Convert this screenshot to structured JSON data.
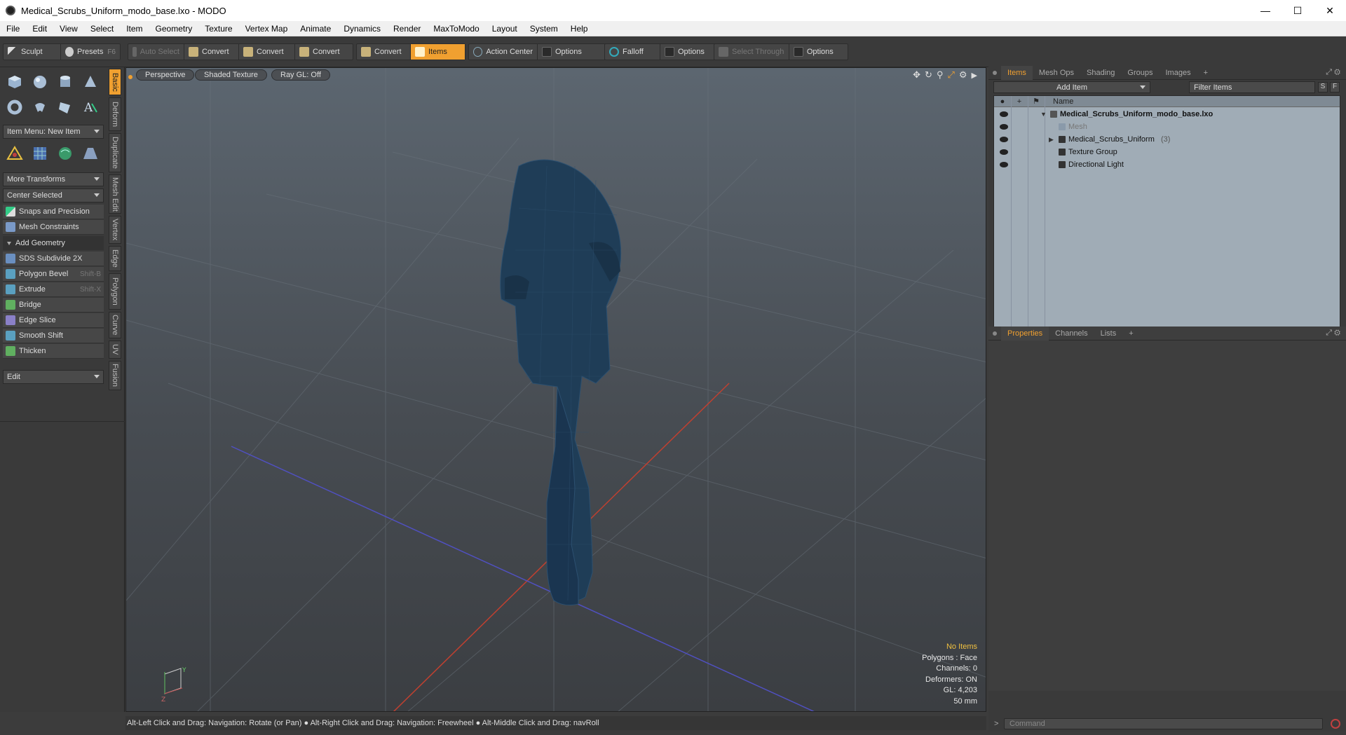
{
  "window": {
    "title": "Medical_Scrubs_Uniform_modo_base.lxo - MODO",
    "minimize": "—",
    "maximize": "☐",
    "close": "✕"
  },
  "menubar": [
    "File",
    "Edit",
    "View",
    "Select",
    "Item",
    "Geometry",
    "Texture",
    "Vertex Map",
    "Animate",
    "Dynamics",
    "Render",
    "MaxToModo",
    "Layout",
    "System",
    "Help"
  ],
  "toolbar": {
    "sculpt": "Sculpt",
    "presets": "Presets",
    "presets_key": "F6",
    "auto_select": "Auto Select",
    "convert1": "Convert",
    "convert2": "Convert",
    "convert3": "Convert",
    "convert4": "Convert",
    "items": "Items",
    "action_center": "Action Center",
    "options1": "Options",
    "falloff": "Falloff",
    "options2": "Options",
    "select_through": "Select Through",
    "options3": "Options"
  },
  "left_panel": {
    "item_menu": "Item Menu: New Item",
    "more_transforms": "More Transforms",
    "center_selected": "Center Selected",
    "snaps": "Snaps and Precision",
    "mesh_constraints": "Mesh Constraints",
    "add_geometry": "Add Geometry",
    "tools": [
      {
        "label": "SDS Subdivide 2X",
        "key": "",
        "color": "#6a8fc0"
      },
      {
        "label": "Polygon Bevel",
        "key": "Shift-B",
        "color": "#5aa0c0"
      },
      {
        "label": "Extrude",
        "key": "Shift-X",
        "color": "#5aa0c0"
      },
      {
        "label": "Bridge",
        "key": "",
        "color": "#60b060"
      },
      {
        "label": "Edge Slice",
        "key": "",
        "color": "#8a80c8"
      },
      {
        "label": "Smooth Shift",
        "key": "",
        "color": "#5aa0c0"
      },
      {
        "label": "Thicken",
        "key": "",
        "color": "#60b060"
      }
    ],
    "edit": "Edit"
  },
  "vertical_tabs": [
    "Basic",
    "Deform",
    "Duplicate",
    "Mesh Edit",
    "Vertex",
    "Edge",
    "Polygon",
    "Curve",
    "UV",
    "Fusion"
  ],
  "viewport": {
    "view_mode": "Perspective",
    "shading": "Shaded Texture",
    "raygl": "Ray GL: Off",
    "info": {
      "no_items": "No Items",
      "polygons": "Polygons : Face",
      "channels": "Channels: 0",
      "deformers": "Deformers: ON",
      "gl": "GL: 4,203",
      "units": "50 mm"
    }
  },
  "statusbar": "Alt-Left Click and Drag: Navigation: Rotate (or Pan) ● Alt-Right Click and Drag: Navigation: Freewheel ● Alt-Middle Click and Drag: navRoll",
  "right_panel": {
    "tabs": [
      "Items",
      "Mesh Ops",
      "Shading",
      "Groups",
      "Images",
      "+"
    ],
    "add_item": "Add Item",
    "filter_items": "Filter Items",
    "s_btn": "S",
    "f_btn": "F",
    "name_header": "Name",
    "tree": [
      {
        "label": "Medical_Scrubs_Uniform_modo_base.lxo",
        "suffix": ""
      },
      {
        "label": "Mesh",
        "suffix": ""
      },
      {
        "label": "Medical_Scrubs_Uniform",
        "suffix": "(3)"
      },
      {
        "label": "Texture Group",
        "suffix": ""
      },
      {
        "label": "Directional Light",
        "suffix": ""
      }
    ],
    "props_tabs": [
      "Properties",
      "Channels",
      "Lists",
      "+"
    ]
  },
  "command": {
    "placeholder": "Command"
  },
  "colors": {
    "accent": "#f0a030",
    "figure": "#1f3d57"
  }
}
